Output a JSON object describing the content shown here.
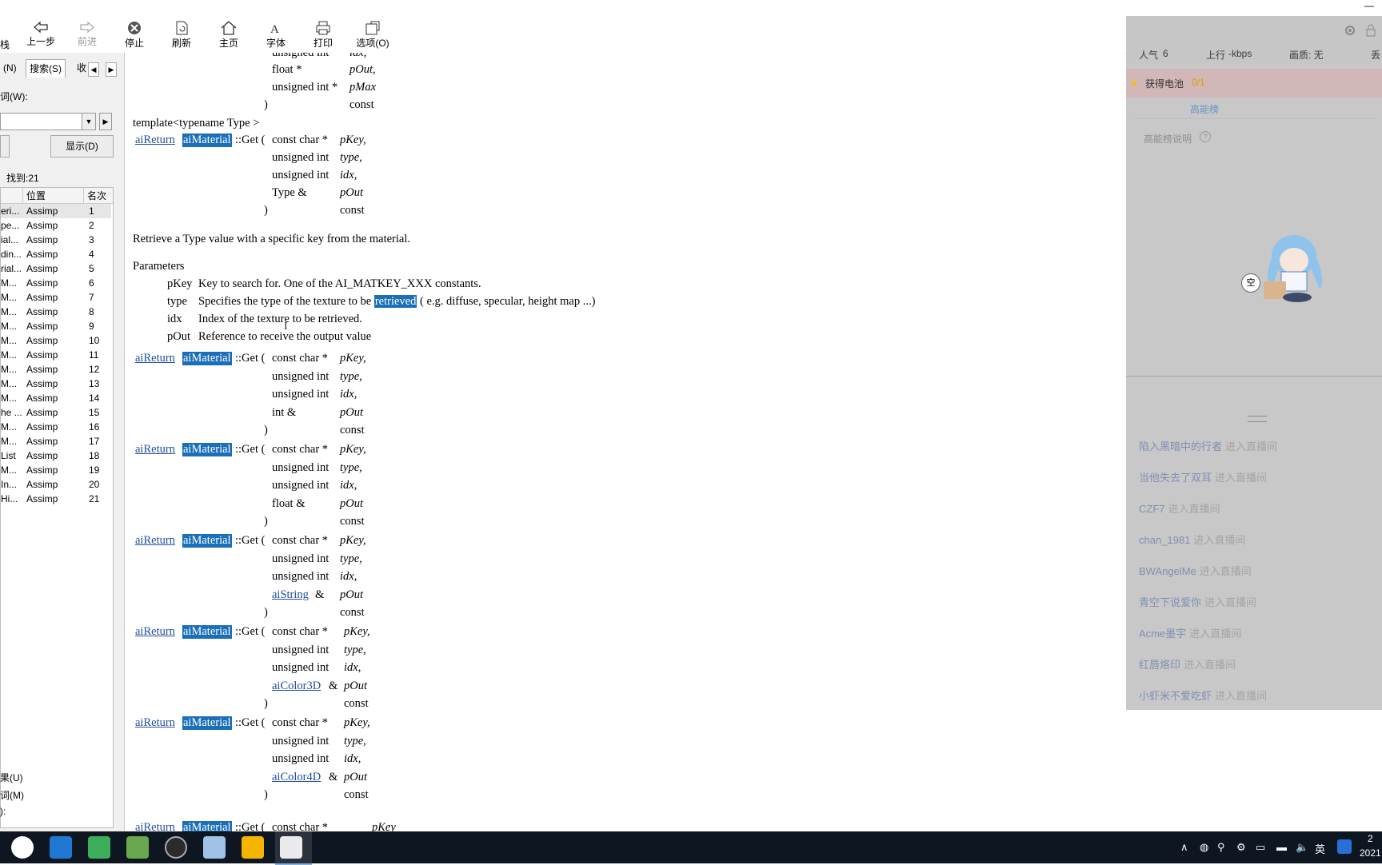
{
  "toolbar": {
    "buttons": [
      {
        "label": "上一步"
      },
      {
        "label": "前进"
      },
      {
        "label": "停止"
      },
      {
        "label": "刷新"
      },
      {
        "label": "主页"
      },
      {
        "label": "字体"
      },
      {
        "label": "打印"
      },
      {
        "label": "选项(O)"
      }
    ],
    "edge_label": "栈",
    "minimize": "—"
  },
  "nav": {
    "tabs": [
      "(N)",
      "搜索(S)",
      "收"
    ],
    "search_label": "词(W):",
    "search_value": "",
    "list_topics_label": "",
    "display_label": "显示(D)",
    "found_text": "找到:21",
    "columns": [
      "",
      "位置",
      "名次"
    ],
    "rows": [
      {
        "title": "eri...",
        "location": "Assimp",
        "rank": "1"
      },
      {
        "title": "pe...",
        "location": "Assimp",
        "rank": "2"
      },
      {
        "title": "ial...",
        "location": "Assimp",
        "rank": "3"
      },
      {
        "title": "din...",
        "location": "Assimp",
        "rank": "4"
      },
      {
        "title": "rial...",
        "location": "Assimp",
        "rank": "5"
      },
      {
        "title": "M...",
        "location": "Assimp",
        "rank": "6"
      },
      {
        "title": "M...",
        "location": "Assimp",
        "rank": "7"
      },
      {
        "title": "M...",
        "location": "Assimp",
        "rank": "8"
      },
      {
        "title": "M...",
        "location": "Assimp",
        "rank": "9"
      },
      {
        "title": "M...",
        "location": "Assimp",
        "rank": "10"
      },
      {
        "title": "M...",
        "location": "Assimp",
        "rank": "11"
      },
      {
        "title": "M...",
        "location": "Assimp",
        "rank": "12"
      },
      {
        "title": "M...",
        "location": "Assimp",
        "rank": "13"
      },
      {
        "title": "M...",
        "location": "Assimp",
        "rank": "14"
      },
      {
        "title": "he ...",
        "location": "Assimp",
        "rank": "15"
      },
      {
        "title": "M...",
        "location": "Assimp",
        "rank": "16"
      },
      {
        "title": "M...",
        "location": "Assimp",
        "rank": "17"
      },
      {
        "title": "List",
        "location": "Assimp",
        "rank": "18"
      },
      {
        "title": "M...",
        "location": "Assimp",
        "rank": "19"
      },
      {
        "title": "In...",
        "location": "Assimp",
        "rank": "20"
      },
      {
        "title": "Hi...",
        "location": "Assimp",
        "rank": "21"
      }
    ],
    "bottom_options": [
      "果(U)",
      "词(M)",
      "):"
    ]
  },
  "doc": {
    "top_partial": [
      "unsigned int",
      "idx,",
      "float *",
      "pOut,",
      "unsigned int *",
      "pMax",
      ")",
      "const"
    ],
    "template_line": "template<typename Type >",
    "ret": "aiReturn",
    "cls": "aiMaterial",
    "get": "::Get (",
    "const_char": "const char *",
    "pkey": "pKey,",
    "uint": "unsigned int",
    "type": "type,",
    "idx": "idx,",
    "close": ")",
    "const": "const",
    "typeref": "Type &",
    "pout": "pOut",
    "description": "Retrieve a Type value with a specific key from the material.",
    "params_heading": "Parameters",
    "params": [
      {
        "name": "pKey",
        "desc": "Key to search for. One of the AI_MATKEY_XXX constants."
      },
      {
        "name": "type",
        "desc_pre": "Specifies the type of the texture to be ",
        "desc_hl": "retrieved",
        "desc_post": " ( e.g. diffuse, specular, height map ...)"
      },
      {
        "name": "idx",
        "desc": "Index of the texture to be retrieved."
      },
      {
        "name": "pOut",
        "desc": "Reference to receive the output value"
      }
    ],
    "overloads": [
      {
        "ptype": "int &",
        "ptype_link": ""
      },
      {
        "ptype": "float &",
        "ptype_link": ""
      },
      {
        "ptype": "&",
        "ptype_link": "aiString"
      },
      {
        "ptype": "&",
        "ptype_link": "aiColor3D"
      },
      {
        "ptype": "&",
        "ptype_link": "aiColor4D"
      }
    ],
    "bottom_partial": {
      "ret": "aiReturn",
      "cls": "aiMaterial",
      "get": "::Get (",
      "cc": "const char *",
      "pkey": "pKey"
    }
  },
  "panel": {
    "popularity_label": "人气",
    "popularity_value": "6",
    "upload_label": "上行",
    "upload_value": "-kbps",
    "quality_label": "画质: 无",
    "edge_char": "丢",
    "battery_label": "获得电池",
    "battery_value": "0/1",
    "tab_active": "高能榜",
    "tab_other": "",
    "rank_note": "高能榜说明",
    "empty_badge": "空",
    "chat": [
      {
        "user": "陷入黑暗中的行者",
        "action": "进入直播间"
      },
      {
        "user": "当他失去了双耳",
        "action": "进入直播间"
      },
      {
        "user": "CZF7",
        "action": "进入直播间"
      },
      {
        "user": "chan_1981",
        "action": "进入直播间"
      },
      {
        "user": "BWAngelMe",
        "action": "进入直播间"
      },
      {
        "user": "青空下说爱你",
        "action": "进入直播间"
      },
      {
        "user": "Acme墨宇",
        "action": "进入直播间"
      },
      {
        "user": "红唇烙印",
        "action": "进入直播间"
      },
      {
        "user": "小虾米不爱吃虾",
        "action": "进入直播间"
      }
    ]
  },
  "taskbar": {
    "ime": "英",
    "time": "2",
    "date": "2021"
  }
}
